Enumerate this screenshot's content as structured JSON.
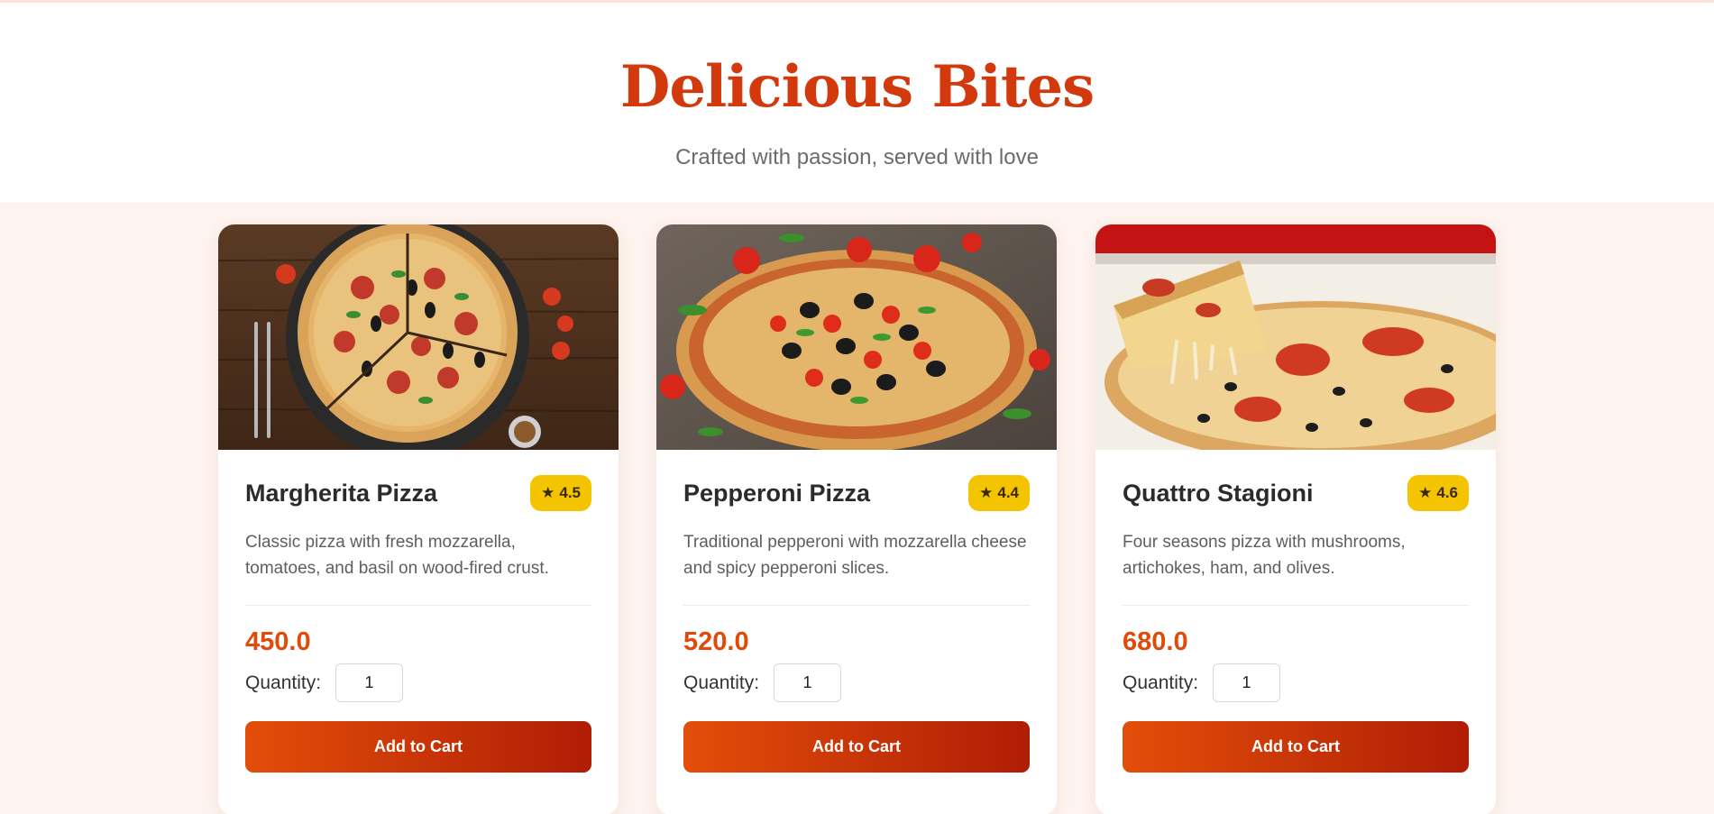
{
  "header": {
    "title": "Delicious Bites",
    "subtitle": "Crafted with passion, served with love"
  },
  "colors": {
    "accent": "#d23a0d",
    "price": "#e04b0b",
    "rating_badge": "#f5c400",
    "button_start": "#e34e09",
    "button_end": "#b01d05",
    "page_background": "#fdf3ef"
  },
  "menu": {
    "quantity_label": "Quantity:",
    "add_to_cart_label": "Add to Cart",
    "rating_icon": "star-icon",
    "items": [
      {
        "name": "Margherita Pizza",
        "rating": "4.5",
        "description": "Classic pizza with fresh mozzarella, tomatoes, and basil on wood-fired crust.",
        "price": "450.0",
        "quantity": "1",
        "image": "pizza-on-wooden-board-image"
      },
      {
        "name": "Pepperoni Pizza",
        "rating": "4.4",
        "description": "Traditional pepperoni with mozzarella cheese and spicy pepperoni slices.",
        "price": "520.0",
        "quantity": "1",
        "image": "pizza-with-olives-and-tomatoes-image"
      },
      {
        "name": "Quattro Stagioni",
        "rating": "4.6",
        "description": "Four seasons pizza with mushrooms, artichokes, ham, and olives.",
        "price": "680.0",
        "quantity": "1",
        "image": "cheesy-pizza-slice-image"
      }
    ]
  }
}
